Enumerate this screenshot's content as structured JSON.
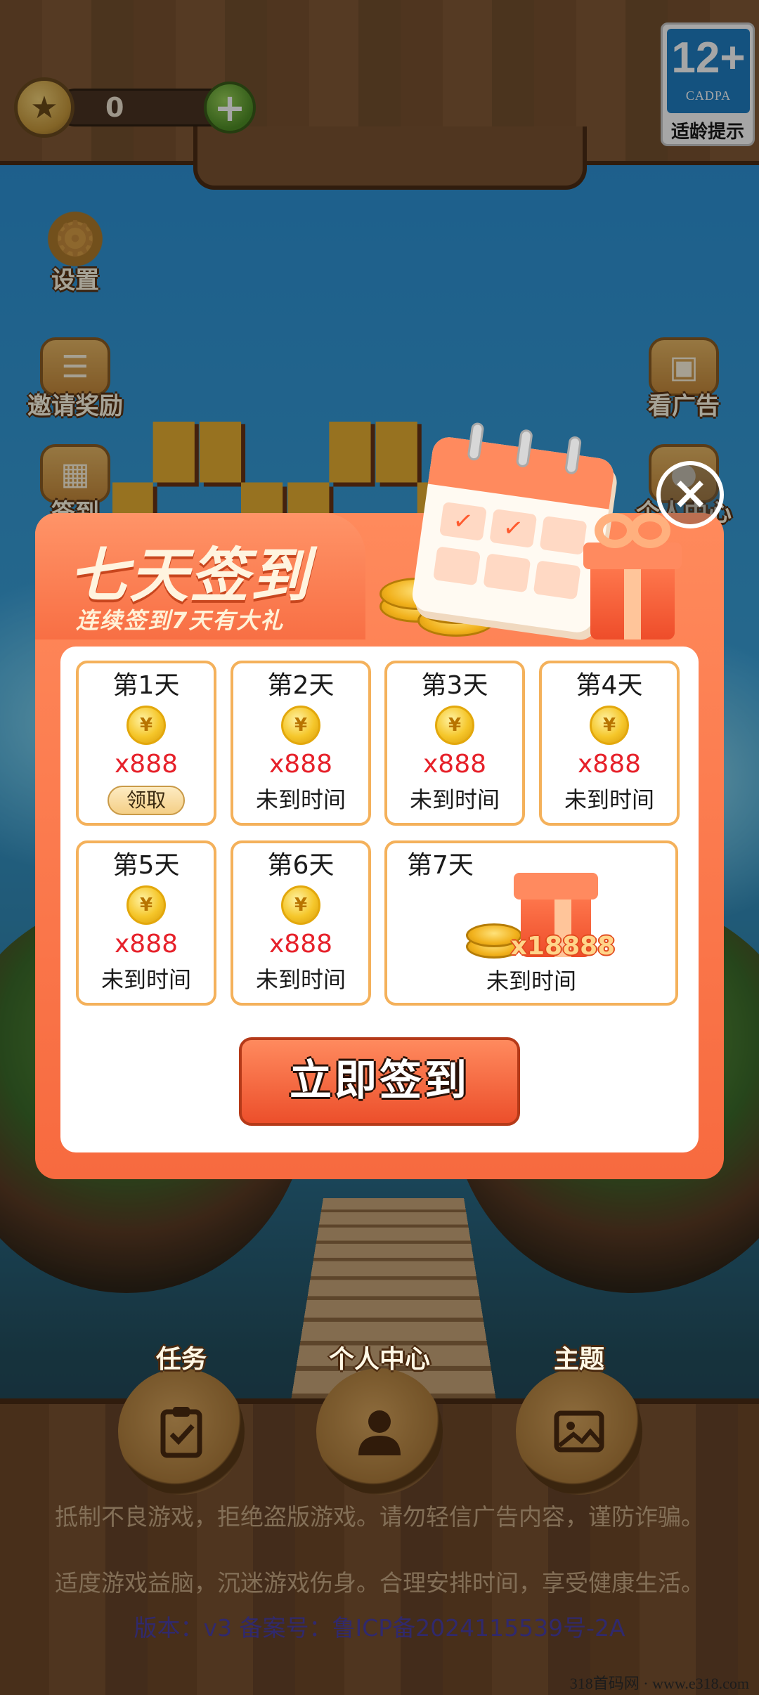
{
  "top_bar": {
    "coin_count": "0",
    "plus": "+"
  },
  "age_badge": {
    "rating": "12+",
    "org": "CADPA",
    "tip": "适龄提示"
  },
  "side_menu": {
    "settings": "设置",
    "invite": "邀请奖励",
    "checkin": "签到",
    "watch_ad": "看广告",
    "profile": "个人中心"
  },
  "modal": {
    "title": "七天签到",
    "subtitle": "连续签到7天有大礼",
    "close": "×",
    "days": [
      {
        "label": "第1天",
        "amount": "x888",
        "status": "领取"
      },
      {
        "label": "第2天",
        "amount": "x888",
        "status": "未到时间"
      },
      {
        "label": "第3天",
        "amount": "x888",
        "status": "未到时间"
      },
      {
        "label": "第4天",
        "amount": "x888",
        "status": "未到时间"
      },
      {
        "label": "第5天",
        "amount": "x888",
        "status": "未到时间"
      },
      {
        "label": "第6天",
        "amount": "x888",
        "status": "未到时间"
      },
      {
        "label": "第7天",
        "amount": "x18888",
        "status": "未到时间"
      }
    ],
    "coin_symbol": "¥",
    "sign_button": "立即签到"
  },
  "bottom_nav": {
    "tasks": "任务",
    "profile": "个人中心",
    "theme": "主题"
  },
  "footer": {
    "line1": "抵制不良游戏，拒绝盗版游戏。请勿轻信广告内容，谨防诈骗。",
    "line2": "适度游戏益脑，沉迷游戏伤身。合理安排时间，享受健康生活。",
    "version": "版本：v3  备案号：鲁ICP备2024115539号-2A"
  },
  "watermark": "318首码网 · www.e318.com"
}
